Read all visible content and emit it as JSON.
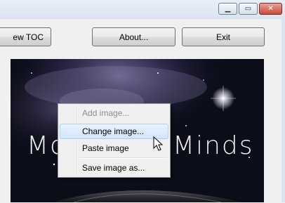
{
  "window": {
    "controls": {
      "minimize_icon": "minimize-icon",
      "maximize_icon": "maximize-icon",
      "close_icon": "close-icon"
    }
  },
  "toolbar": {
    "toc_label": "ew TOC",
    "about_label": "About...",
    "exit_label": "Exit"
  },
  "image": {
    "text_left": "Mo",
    "text_right": "Minds",
    "description_icon": "galaxy-image"
  },
  "context_menu": {
    "items": [
      {
        "label": "Add image...",
        "enabled": false
      },
      {
        "label": "Change image...",
        "enabled": true,
        "highlighted": true
      },
      {
        "label": "Paste image",
        "enabled": true
      },
      {
        "label": "Save image as...",
        "enabled": true
      }
    ]
  },
  "colors": {
    "menu_highlight": "#d1e6fb",
    "close_button": "#c74a3a",
    "image_background": "#0b0d18"
  }
}
